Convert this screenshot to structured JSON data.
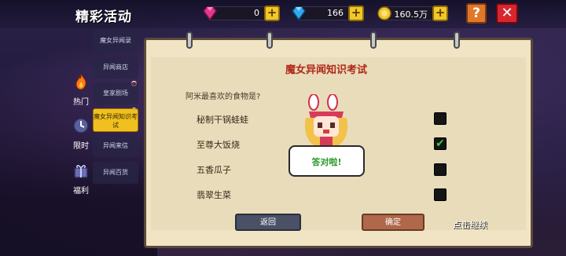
{
  "header": {
    "title": "精彩活动",
    "gems": "0",
    "diamonds": "166",
    "gold": "160.5万",
    "plus_label": "+",
    "help_label": "?",
    "close_label": "✕"
  },
  "side_tabs": [
    {
      "label": "热门",
      "icon": "fire-icon",
      "active": true
    },
    {
      "label": "限时",
      "icon": "clock-icon",
      "active": false
    },
    {
      "label": "福利",
      "icon": "gift-icon",
      "active": false
    }
  ],
  "menu": [
    {
      "label": "魔女异闻录",
      "dot": false
    },
    {
      "label": "异闻商店",
      "dot": true
    },
    {
      "label": "皇家剧场",
      "dot": true
    },
    {
      "label": "魔女异闻知识考试",
      "dot": true,
      "active": true
    },
    {
      "label": "异闻来信",
      "dot": false
    },
    {
      "label": "异闻百货",
      "dot": false
    }
  ],
  "quiz": {
    "title": "魔女异闻知识考试",
    "question": "阿米最喜欢的食物是?",
    "options": [
      {
        "label": "秘制干锅蛙蛙",
        "checked": false
      },
      {
        "label": "至尊大饭烧",
        "checked": true
      },
      {
        "label": "五香瓜子",
        "checked": false
      },
      {
        "label": "翡翠生菜",
        "checked": false
      }
    ],
    "back_label": "返回",
    "confirm_label": "确定",
    "continue_label": "点击继续",
    "bubble_text": "答对啦!",
    "check_mark": "✔"
  },
  "colors": {
    "accent_gold": "#f0c020",
    "title_red": "#b0281c",
    "correct_green": "#2f9a30"
  }
}
